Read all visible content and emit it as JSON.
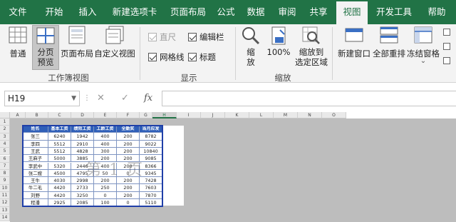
{
  "tabs": [
    {
      "label": "文件",
      "active": false
    },
    {
      "label": "开始",
      "active": false
    },
    {
      "label": "插入",
      "active": false
    },
    {
      "label": "新建选项卡",
      "active": false
    },
    {
      "label": "页面布局",
      "active": false
    },
    {
      "label": "公式",
      "active": false
    },
    {
      "label": "数据",
      "active": false
    },
    {
      "label": "审阅",
      "active": false
    },
    {
      "label": "共享",
      "active": false
    },
    {
      "label": "视图",
      "active": true
    },
    {
      "label": "开发工具",
      "active": false
    },
    {
      "label": "帮助",
      "active": false
    }
  ],
  "ribbon": {
    "workbook_views": {
      "group_label": "工作簿视图",
      "normal": "普通",
      "page_break_line1": "分页",
      "page_break_line2": "预览",
      "page_layout": "页面布局",
      "custom_views": "自定义视图"
    },
    "show": {
      "group_label": "显示",
      "ruler": "直尺",
      "formula_bar": "编辑栏",
      "gridlines": "网格线",
      "headings": "标题"
    },
    "zoom": {
      "group_label": "缩放",
      "zoom_line1": "缩",
      "zoom_line2": "放",
      "zoom_100": "100%",
      "zoom_selection_line1": "缩放到",
      "zoom_selection_line2": "选定区域"
    },
    "window": {
      "new_window": "新建窗口",
      "arrange_all": "全部重排",
      "freeze_panes": "冻结窗格",
      "dropdown_glyph": "⌄"
    }
  },
  "formula_bar": {
    "name_box": "H19",
    "name_dropdown_glyph": "▼",
    "dots_glyph": "⋮",
    "cancel_glyph": "✕",
    "enter_glyph": "✓",
    "fx_label": "fx",
    "value": ""
  },
  "grid": {
    "columns": [
      "A",
      "B",
      "C",
      "D",
      "E",
      "F",
      "G",
      "H",
      "I",
      "J",
      "K",
      "L",
      "M",
      "N",
      "O"
    ],
    "selected_column": "H",
    "rows": [
      "1",
      "2",
      "3",
      "4",
      "5",
      "6",
      "7",
      "8",
      "9",
      "10",
      "11",
      "12",
      "13",
      "14"
    ],
    "watermark": "第 1 页",
    "headers": [
      "姓名",
      "基本工资",
      "绩效工资",
      "工龄工资",
      "全勤奖",
      "当月应发"
    ],
    "table": [
      [
        "张三",
        "6240",
        "1942",
        "400",
        "200",
        "8782"
      ],
      [
        "李四",
        "5512",
        "2910",
        "400",
        "200",
        "9022"
      ],
      [
        "王武",
        "5512",
        "4828",
        "300",
        "200",
        "10840"
      ],
      [
        "王麻子",
        "5000",
        "3885",
        "200",
        "200",
        "9085"
      ],
      [
        "李武中",
        "5320",
        "2446",
        "400",
        "200",
        "8366"
      ],
      [
        "张二嫂",
        "4500",
        "4795",
        "50",
        "0",
        "9345"
      ],
      [
        "王牛",
        "4030",
        "2998",
        "200",
        "200",
        "7428"
      ],
      [
        "牛二毛",
        "4420",
        "2733",
        "250",
        "200",
        "7603"
      ],
      [
        "刘野",
        "4420",
        "3250",
        "0",
        "200",
        "7870"
      ],
      [
        "程潘",
        "2925",
        "2085",
        "100",
        "0",
        "5110"
      ]
    ]
  },
  "colors": {
    "accent": "#217346",
    "table_header": "#2f5fb8",
    "table_border": "#1f3fa8"
  }
}
